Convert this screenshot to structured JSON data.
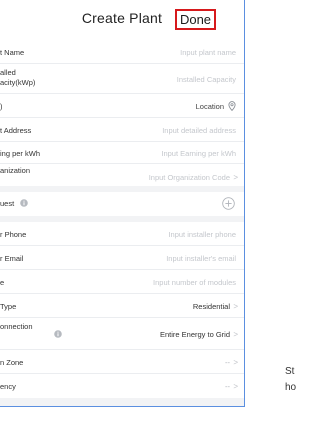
{
  "nav": {
    "title": "Create Plant",
    "done_label": "Done"
  },
  "group1": [
    {
      "label": "t Name",
      "value": "Input plant name"
    },
    {
      "label": "alled",
      "label2": "acity(kWp)",
      "value": "Installed Capacity"
    },
    {
      "label": ")",
      "value": "Location"
    },
    {
      "label": "t Address",
      "value": "Input detailed address"
    },
    {
      "label": "ing per kWh",
      "value": "Input Earning per kWh"
    },
    {
      "label": "anization",
      "value": "Input Organization Code"
    }
  ],
  "group2": [
    {
      "label": "uest"
    }
  ],
  "group3": [
    {
      "label": "r Phone",
      "value": "Input installer phone"
    },
    {
      "label": "r Email",
      "value": "Input installer's email"
    },
    {
      "label": "e",
      "value": "Input number of modules"
    },
    {
      "label": "Type",
      "value": "Residential"
    },
    {
      "label": "onnection",
      "value": "Entire Energy to Grid"
    },
    {
      "label": "n Zone",
      "value": "-- "
    },
    {
      "label": "ency",
      "value": "-- "
    }
  ],
  "side": {
    "line1": "St",
    "line2": "ho"
  }
}
